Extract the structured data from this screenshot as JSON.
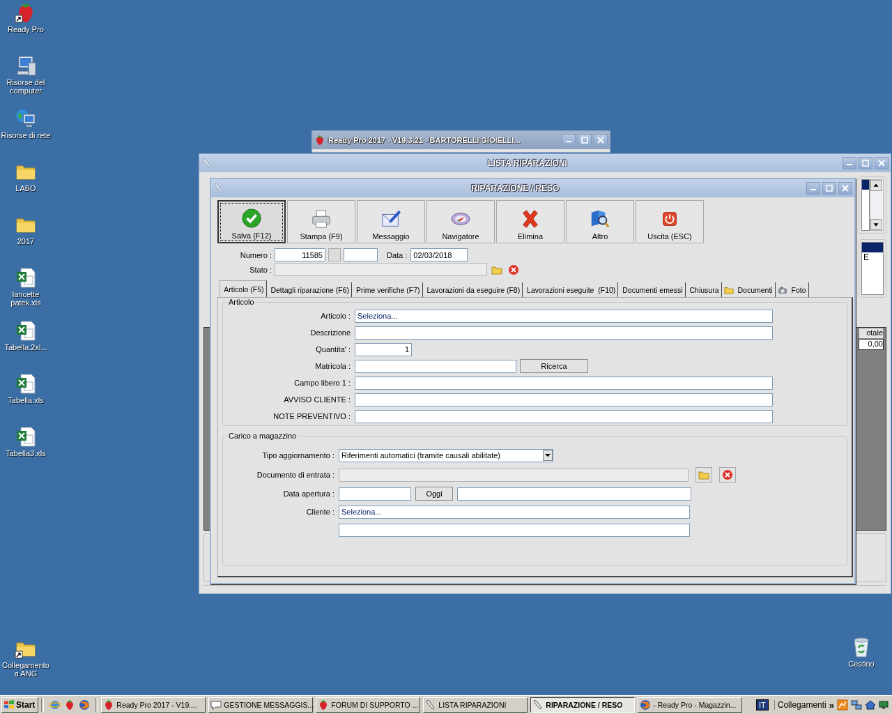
{
  "desktop": {
    "icons": [
      {
        "label": "Ready Pro",
        "kind": "strawberry",
        "shortcut": true
      },
      {
        "label": "Risorse del computer",
        "kind": "computer",
        "shortcut": false
      },
      {
        "label": "Risorse di rete",
        "kind": "network",
        "shortcut": false
      },
      {
        "label": "LABO",
        "kind": "folder",
        "shortcut": false
      },
      {
        "label": "2017",
        "kind": "folder",
        "shortcut": false
      },
      {
        "label": "lancette patek.xls",
        "kind": "spreadsheet",
        "shortcut": false
      },
      {
        "label": "Tabella.2xl...",
        "kind": "spreadsheet",
        "shortcut": false
      },
      {
        "label": "Tabella.xls",
        "kind": "spreadsheet",
        "shortcut": false
      },
      {
        "label": "Tabella3.xls",
        "kind": "spreadsheet",
        "shortcut": false
      }
    ],
    "corner_icon": {
      "label": "Collegamento a ANG",
      "kind": "folder",
      "shortcut": true
    },
    "recycle_bin": {
      "label": "Cestino"
    }
  },
  "back_window": {
    "title": "Ready Pro 2017 - V19.3.21 - BARTORELLI GIOIELLI..."
  },
  "list_window": {
    "title": "LISTA RIPARAZIONI",
    "list_item": "E",
    "grid_header": "otale",
    "grid_cell": "0,00"
  },
  "form_window": {
    "title": "RIPARAZIONE / RESO",
    "toolbar": [
      {
        "label": "Salva (F12)",
        "kind": "save",
        "selected": true
      },
      {
        "label": "Stampa (F9)",
        "kind": "print",
        "selected": false
      },
      {
        "label": "Messaggio",
        "kind": "message",
        "selected": false
      },
      {
        "label": "Navigatore",
        "kind": "navigator",
        "selected": false
      },
      {
        "label": "Elimina",
        "kind": "delete",
        "selected": false
      },
      {
        "label": "Altro",
        "kind": "other",
        "selected": false
      },
      {
        "label": "Uscita (ESC)",
        "kind": "exit",
        "selected": false
      }
    ],
    "numero": {
      "label": "Numero :",
      "value": "11585"
    },
    "data": {
      "label": "Data :",
      "value": "02/03/2018"
    },
    "stato": {
      "label": "Stato :",
      "disabled": true
    },
    "tabs": [
      {
        "label": "Articolo (F5)",
        "selected": true
      },
      {
        "label": "Dettagli riparazione (F6)",
        "selected": false
      },
      {
        "label": "Prime verifiche (F7)",
        "selected": false
      },
      {
        "label": "Lavorazioni da eseguire (F8)",
        "selected": false
      },
      {
        "label": "Lavorazioni eseguite  (F10)",
        "selected": false
      },
      {
        "label": "Documenti emessi",
        "selected": false
      },
      {
        "label": "Chiusura",
        "selected": false
      },
      {
        "label": "Documenti",
        "kind": "folder",
        "selected": false
      },
      {
        "label": "Foto",
        "kind": "camera",
        "selected": false
      }
    ],
    "articolo_group": {
      "title": "Articolo",
      "fields": [
        {
          "label": "Articolo :",
          "kind": "wide",
          "value": "Seleziona..."
        },
        {
          "label": "Descrizione",
          "kind": "wide"
        },
        {
          "label": "Quantita' :",
          "kind": "number",
          "value": "1"
        },
        {
          "label": "Matricola :",
          "kind": "search",
          "button": "Ricerca"
        },
        {
          "label": "Campo libero 1 :",
          "kind": "wide"
        },
        {
          "label": "AVVISO CLIENTE :",
          "kind": "wide"
        },
        {
          "label": "NOTE PREVENTIVO :",
          "kind": "wide"
        }
      ]
    },
    "carico_group": {
      "title": "Carico a magazzino",
      "fields": [
        {
          "label": "Tipo aggiornamento :",
          "kind": "select",
          "value": "Riferimenti automatici (tramite causali abilitate)"
        },
        {
          "label": "Documento di entrata :",
          "kind": "picker",
          "disabled": true
        },
        {
          "label": "Data apertura :",
          "kind": "date",
          "button": "Oggi"
        },
        {
          "label": "Cliente :",
          "kind": "client",
          "value": "Seleziona..."
        },
        {
          "kind": "client"
        }
      ]
    }
  },
  "taskbar": {
    "start": "Start",
    "tasks": [
      {
        "label": "Ready Pro 2017 - V19....",
        "kind": "strawberry",
        "selected": false
      },
      {
        "label": "GESTIONE MESSAGGIS...",
        "kind": "message",
        "selected": false
      },
      {
        "label": "FORUM DI SUPPORTO ...",
        "kind": "strawberry",
        "selected": false
      },
      {
        "label": "LISTA RIPARAZIONI",
        "kind": "wrench",
        "selected": false
      },
      {
        "label": "RIPARAZIONE / RESO",
        "kind": "wrench",
        "selected": true
      },
      {
        "label": "- Ready Pro - Magazzin...",
        "kind": "browser",
        "selected": false
      }
    ],
    "language": "IT",
    "links": "Collegamenti",
    "more": "»"
  }
}
